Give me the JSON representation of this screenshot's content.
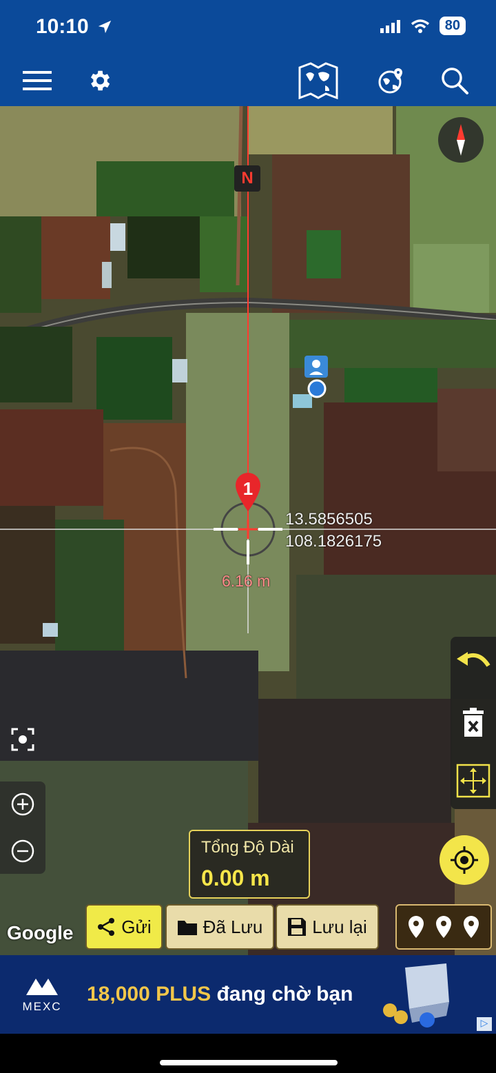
{
  "status_bar": {
    "time": "10:10",
    "battery": "80"
  },
  "toolbar": {
    "icons": [
      "menu-icon",
      "gear-icon",
      "world-map-icon",
      "globe-pin-icon",
      "search-icon"
    ]
  },
  "map": {
    "north_label": "N",
    "marker_label": "1",
    "latitude": "13.5856505",
    "longitude": "108.1826175",
    "distance": "6.16 m",
    "attribution": "Google"
  },
  "measure": {
    "total_label": "Tổng Độ Dài",
    "total_value": "0.00 m"
  },
  "actions": {
    "send": "Gửi",
    "saved": "Đã Lưu",
    "save": "Lưu lại"
  },
  "ad": {
    "brand": "MEXC",
    "text_highlight": "18,000 PLUS",
    "text_rest": "đang chờ bạn"
  },
  "colors": {
    "header": "#0b4a9a",
    "accent_yellow": "#f0ea48",
    "line_red": "#ff3b30"
  }
}
